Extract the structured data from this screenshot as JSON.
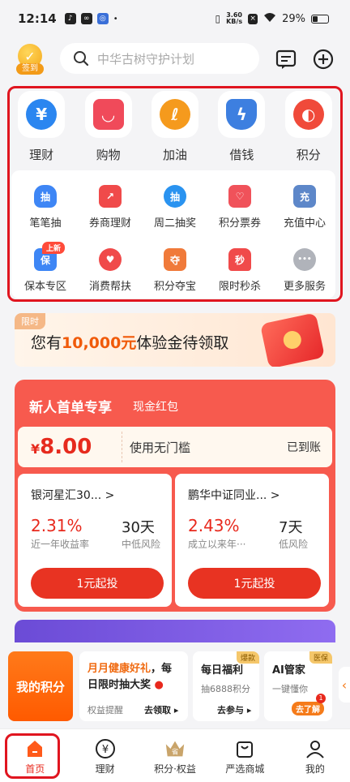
{
  "status_bar": {
    "time": "12:14",
    "speed_value": "3.60",
    "speed_unit": "KB/s",
    "battery": "29%"
  },
  "header": {
    "sign_in": "签到",
    "search_placeholder": "中华古树守护计划"
  },
  "top_icons": [
    {
      "label": "理财",
      "icon": "yuan-icon",
      "color": "#2b86f0"
    },
    {
      "label": "购物",
      "icon": "shopping-bag-icon",
      "color": "#f04a5a"
    },
    {
      "label": "加油",
      "icon": "fuel-icon",
      "color": "#f59a1d"
    },
    {
      "label": "借钱",
      "icon": "lightning-shield-icon",
      "color": "#3d7fe0"
    },
    {
      "label": "积分",
      "icon": "points-icon",
      "color": "#f04a3a"
    }
  ],
  "grid_items": [
    {
      "label": "笔笔抽",
      "icon_text": "抽",
      "color": "#3e86f5"
    },
    {
      "label": "券商理财",
      "icon_text": "",
      "color": "#f04a4a"
    },
    {
      "label": "周二抽奖",
      "icon_text": "抽",
      "color": "#2a93f0"
    },
    {
      "label": "积分票券",
      "icon_text": "",
      "color": "#f0525a"
    },
    {
      "label": "充值中心",
      "icon_text": "充",
      "color": "#5d87c9"
    },
    {
      "label": "保本专区",
      "icon_text": "保",
      "color": "#3e86f5",
      "badge": "上新"
    },
    {
      "label": "消费帮扶",
      "icon_text": "",
      "color": "#f04a4a"
    },
    {
      "label": "积分夺宝",
      "icon_text": "夺",
      "color": "#f07a3a"
    },
    {
      "label": "限时秒杀",
      "icon_text": "秒",
      "color": "#f04a4a"
    },
    {
      "label": "更多服务",
      "icon_text": "•••",
      "color": "#b0b3ba"
    }
  ],
  "banner": {
    "tag": "限时",
    "prefix": "您有",
    "amount": "10,000元",
    "suffix": "体验金待领取"
  },
  "promo": {
    "title": "新人首单专享",
    "subtitle": "现金红包",
    "coupon_currency": "¥",
    "coupon_amount": "8.00",
    "coupon_use": "使用无门槛",
    "coupon_status": "已到账",
    "funds": [
      {
        "name": "银河星汇30... >",
        "rate": "2.31%",
        "rate_label": "近一年收益率",
        "term": "30天",
        "risk": "中低风险",
        "button": "1元起投"
      },
      {
        "name": "鹏华中证同业... >",
        "rate": "2.43%",
        "rate_label": "成立以来年···",
        "term": "7天",
        "risk": "低风险",
        "button": "1元起投"
      }
    ]
  },
  "bottom_cards": {
    "my_points": "我的积分",
    "health": {
      "line1_highlight": "月月健康好礼",
      "line1_rest": "，每",
      "line2": "日限时抽大奖",
      "sub": "权益提醒",
      "action": "去领取 ▸"
    },
    "daily": {
      "ribbon": "爆款",
      "title": "每日福利",
      "sub": "抽6888积分",
      "action": "去参与 ▸"
    },
    "ai": {
      "ribbon": "医保",
      "title": "AI管家",
      "sub": "一键懂你",
      "action": "去了解",
      "badge": "1"
    },
    "arrow": "‹"
  },
  "tabbar": [
    {
      "label": "首页",
      "icon": "home-icon",
      "active": true
    },
    {
      "label": "理财",
      "icon": "yuan-circle-icon",
      "active": false
    },
    {
      "label": "积分·权益",
      "icon": "crown-icon",
      "active": false
    },
    {
      "label": "严选商城",
      "icon": "bag-icon",
      "active": false
    },
    {
      "label": "我的",
      "icon": "user-icon",
      "active": false
    }
  ]
}
